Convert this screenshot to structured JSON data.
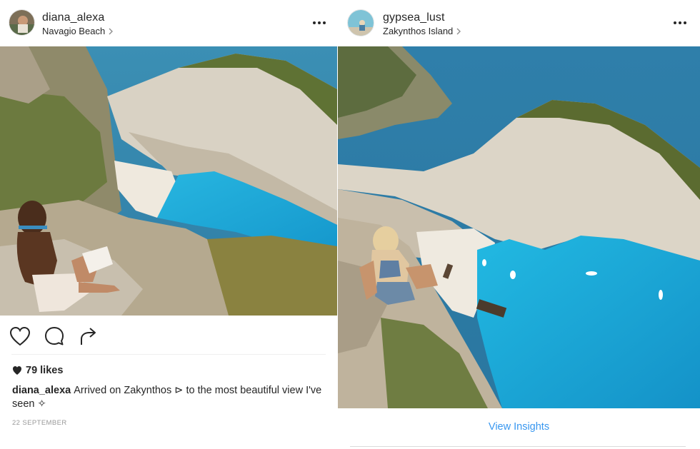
{
  "posts": [
    {
      "username": "diana_alexa",
      "location": "Navagio Beach",
      "likes": "79 likes",
      "caption_user": "diana_alexa",
      "caption_text": "Arrived on Zakynthos ⊳ to the most beautiful view I've seen ✧",
      "timestamp": "22 SEPTEMBER",
      "actions": [
        "heart-icon",
        "comment-icon",
        "share-icon"
      ]
    },
    {
      "username": "gypsea_lust",
      "location": "Zakynthos Island",
      "insights_link": "View Insights"
    }
  ],
  "colors": {
    "text": "#262626",
    "muted": "#999999",
    "link": "#3897f0",
    "sea": "#1aa3c9",
    "cliff": "#d8d2c6"
  }
}
